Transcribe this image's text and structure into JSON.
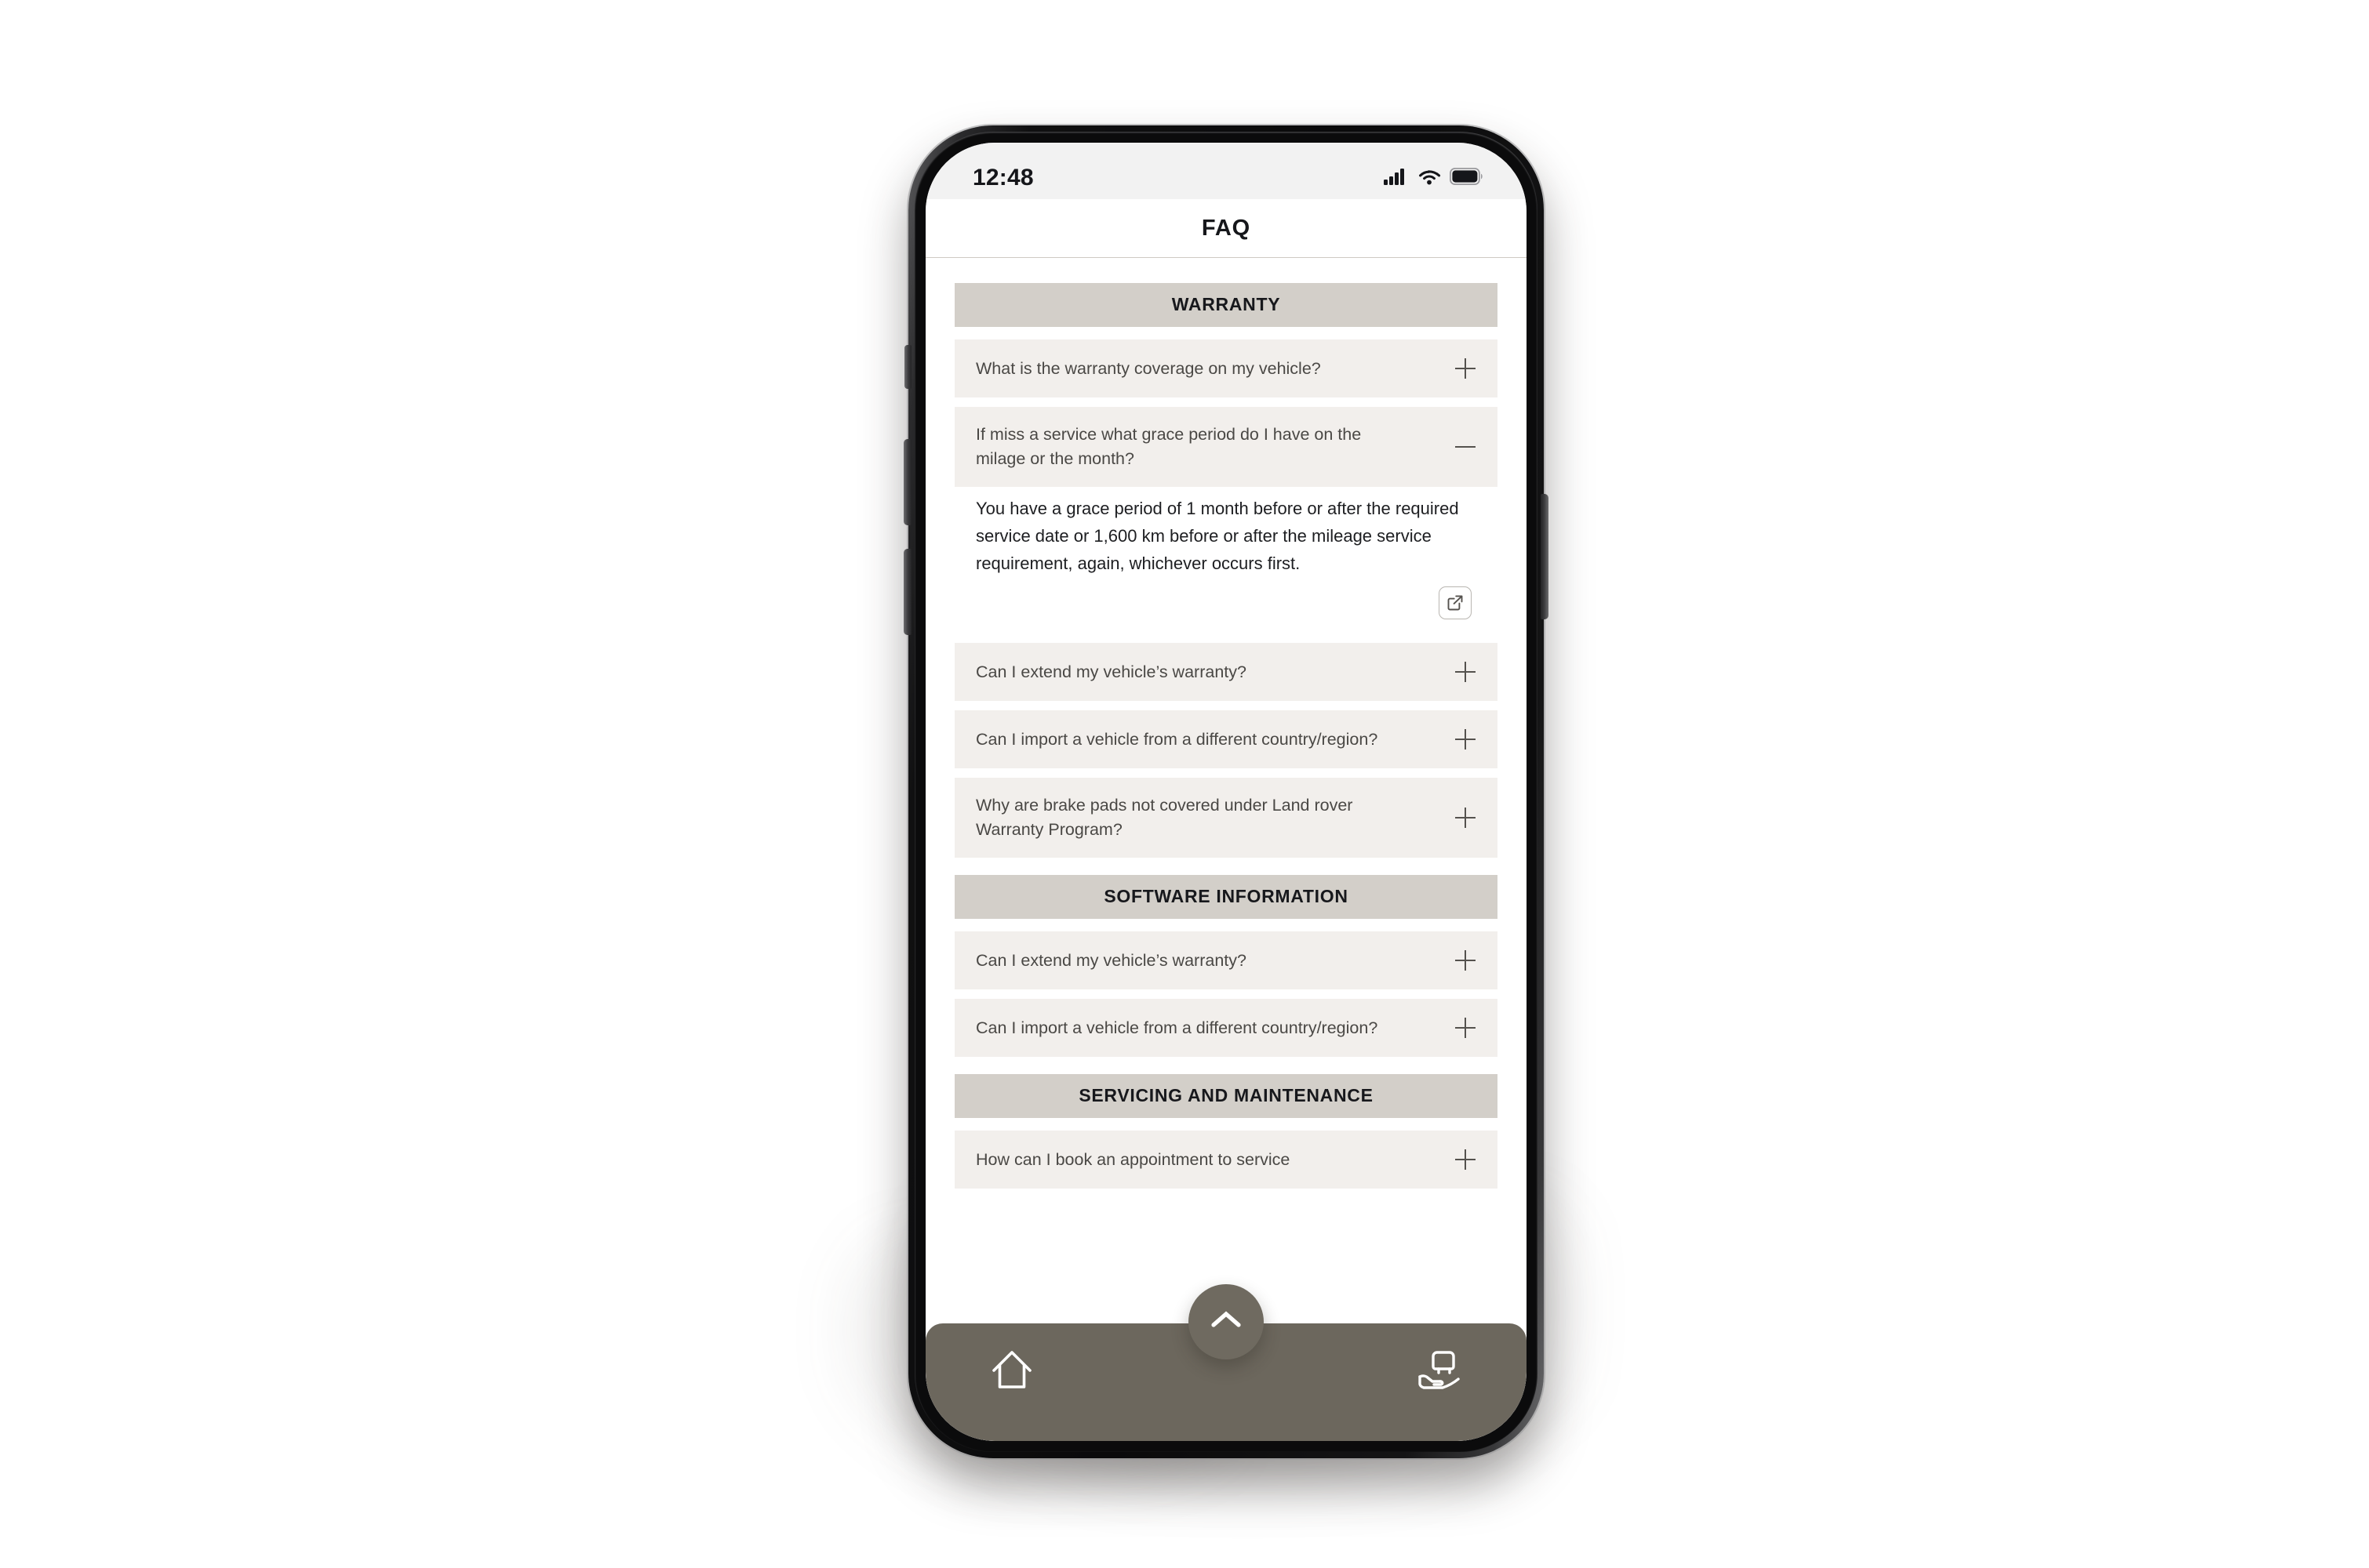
{
  "status_bar": {
    "time": "12:48",
    "icons": [
      "cellular-signal-icon",
      "wifi-icon",
      "battery-icon"
    ]
  },
  "header": {
    "title": "FAQ"
  },
  "theme": {
    "section_header_bg": "#D3CFC9",
    "question_row_bg": "#F2EFEC",
    "bottom_nav_bg": "#6C675D",
    "question_text": "#4A4845",
    "answer_text": "#1D1E21",
    "screen_bg": "#FFFFFF",
    "status_bar_bg": "#F2F2F2"
  },
  "sections": [
    {
      "title": "WARRANTY",
      "items": [
        {
          "question": "What is the warranty coverage on my vehicle?",
          "toggle": "plus",
          "expanded": false
        },
        {
          "question": "If miss a service  what grace period do I have on the milage or the month?",
          "toggle": "minus",
          "expanded": true,
          "answer": "You have a grace period of 1 month before or after the required service date or 1,600 km before or after the mileage service requirement, again, whichever occurs first.",
          "share_icon": "share-icon"
        },
        {
          "question": "Can I extend my vehicle’s warranty?",
          "toggle": "plus",
          "expanded": false
        },
        {
          "question": "Can I import a vehicle from a different country/region?",
          "toggle": "plus",
          "expanded": false
        },
        {
          "question": "Why are brake pads not covered under Land rover Warranty Program?",
          "toggle": "plus",
          "expanded": false
        }
      ]
    },
    {
      "title": "SOFTWARE INFORMATION",
      "items": [
        {
          "question": "Can I extend my vehicle’s warranty?",
          "toggle": "plus",
          "expanded": false
        },
        {
          "question": "Can I import a vehicle from a different country/region?",
          "toggle": "plus",
          "expanded": false
        }
      ]
    },
    {
      "title": "SERVICING AND MAINTENANCE",
      "items": [
        {
          "question": "How can I book an appointment to service",
          "toggle": "plus",
          "expanded": false
        }
      ]
    }
  ],
  "bottom_nav": {
    "home_icon": "home-icon",
    "service_icon": "car-in-hand-icon",
    "fab_icon": "chevron-up-icon"
  }
}
